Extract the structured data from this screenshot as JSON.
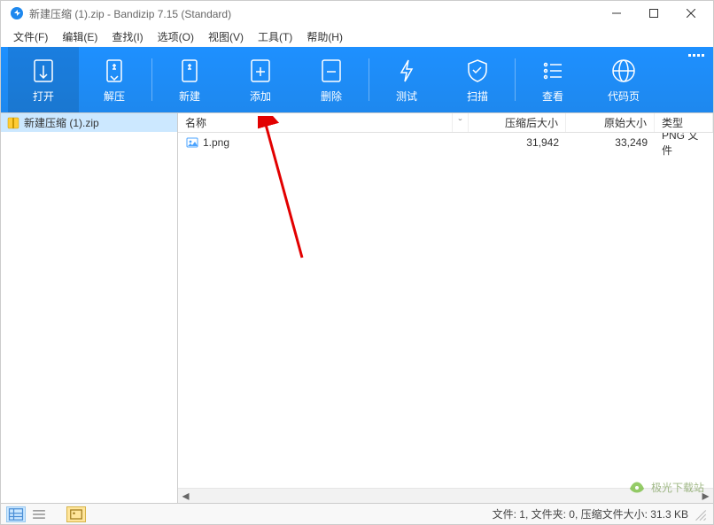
{
  "title": "新建压缩 (1).zip - Bandizip 7.15 (Standard)",
  "menu": {
    "file": "文件(F)",
    "edit": "编辑(E)",
    "find": "查找(I)",
    "options": "选项(O)",
    "view": "视图(V)",
    "tools": "工具(T)",
    "help": "帮助(H)"
  },
  "toolbar": {
    "open": "打开",
    "extract": "解压",
    "new": "新建",
    "add": "添加",
    "delete": "删除",
    "test": "测试",
    "scan": "扫描",
    "view": "查看",
    "codepage": "代码页"
  },
  "tree": {
    "root": "新建压缩 (1).zip"
  },
  "columns": {
    "name": "名称",
    "csize": "压缩后大小",
    "osize": "原始大小",
    "type": "类型"
  },
  "files": [
    {
      "name": "1.png",
      "csize": "31,942",
      "osize": "33,249",
      "type": "PNG 文件"
    }
  ],
  "status": {
    "text": "文件: 1, 文件夹: 0, 压缩文件大小: 31.3 KB"
  },
  "watermark": "极光下载站"
}
